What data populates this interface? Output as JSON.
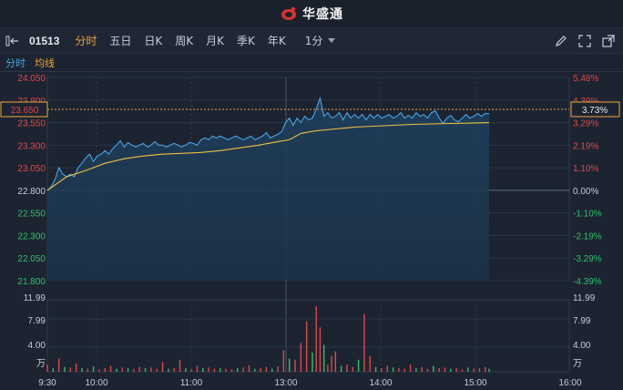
{
  "header": {
    "brand": "华盛通"
  },
  "toolbar": {
    "code": "01513",
    "tabs": [
      "分时",
      "五日",
      "日K",
      "周K",
      "月K",
      "季K",
      "年K"
    ],
    "active_tab": 0,
    "interval": "1分"
  },
  "subtabs": {
    "intraday": "分时",
    "avg": "均线"
  },
  "price_axis": {
    "labels": [
      "24.050",
      "23.800",
      "23.550",
      "23.300",
      "23.050",
      "22.800",
      "22.550",
      "22.300",
      "22.050",
      "21.800"
    ],
    "current": "23.650"
  },
  "pct_axis": {
    "labels": [
      "5.48%",
      "4.39%",
      "3.29%",
      "2.19%",
      "1.10%",
      "0.00%",
      "-1.10%",
      "-2.19%",
      "-3.29%",
      "-4.39%"
    ],
    "current": "3.73%"
  },
  "volume_axis": {
    "left": [
      "11.99",
      "7.99",
      "4.00",
      "万"
    ],
    "right": [
      "11.99",
      "7.99",
      "4.00",
      "万"
    ]
  },
  "time_axis": [
    "9:30",
    "10:00",
    "11:00",
    "13:00",
    "14:00",
    "15:00",
    "16:00"
  ],
  "colors": {
    "price_line": "#4aa3e6",
    "avg_line": "#f0c040",
    "up": "#e04848",
    "down": "#2fc06a",
    "accent": "#f0a33a"
  },
  "chart_data": {
    "type": "line",
    "prev_close": 22.8,
    "ylim": [
      21.8,
      24.05
    ],
    "volume_max": 11.99,
    "price_points": [
      [
        0,
        22.8
      ],
      [
        2,
        22.84
      ],
      [
        4,
        22.92
      ],
      [
        6,
        23.05
      ],
      [
        8,
        22.98
      ],
      [
        10,
        22.95
      ],
      [
        12,
        22.98
      ],
      [
        14,
        22.95
      ],
      [
        16,
        23.05
      ],
      [
        18,
        23.1
      ],
      [
        20,
        23.16
      ],
      [
        22,
        23.2
      ],
      [
        24,
        23.12
      ],
      [
        26,
        23.18
      ],
      [
        28,
        23.2
      ],
      [
        30,
        23.24
      ],
      [
        32,
        23.2
      ],
      [
        34,
        23.26
      ],
      [
        36,
        23.3
      ],
      [
        38,
        23.35
      ],
      [
        40,
        23.28
      ],
      [
        42,
        23.33
      ],
      [
        44,
        23.3
      ],
      [
        46,
        23.28
      ],
      [
        48,
        23.3
      ],
      [
        50,
        23.32
      ],
      [
        52,
        23.28
      ],
      [
        54,
        23.3
      ],
      [
        56,
        23.34
      ],
      [
        58,
        23.3
      ],
      [
        60,
        23.3
      ],
      [
        62,
        23.28
      ],
      [
        64,
        23.3
      ],
      [
        66,
        23.32
      ],
      [
        68,
        23.3
      ],
      [
        70,
        23.28
      ],
      [
        72,
        23.3
      ],
      [
        74,
        23.33
      ],
      [
        76,
        23.32
      ],
      [
        78,
        23.3
      ],
      [
        80,
        23.36
      ],
      [
        82,
        23.38
      ],
      [
        84,
        23.36
      ],
      [
        86,
        23.4
      ],
      [
        88,
        23.38
      ],
      [
        90,
        23.4
      ],
      [
        92,
        23.38
      ],
      [
        94,
        23.36
      ],
      [
        96,
        23.38
      ],
      [
        98,
        23.4
      ],
      [
        100,
        23.38
      ],
      [
        102,
        23.36
      ],
      [
        104,
        23.38
      ],
      [
        106,
        23.4
      ],
      [
        108,
        23.36
      ],
      [
        110,
        23.38
      ],
      [
        112,
        23.4
      ],
      [
        114,
        23.44
      ],
      [
        116,
        23.38
      ],
      [
        118,
        23.4
      ],
      [
        120,
        23.42
      ],
      [
        122,
        23.45
      ],
      [
        124,
        23.55
      ],
      [
        126,
        23.6
      ],
      [
        128,
        23.52
      ],
      [
        130,
        23.6
      ],
      [
        132,
        23.55
      ],
      [
        134,
        23.62
      ],
      [
        136,
        23.58
      ],
      [
        138,
        23.6
      ],
      [
        140,
        23.7
      ],
      [
        142,
        23.82
      ],
      [
        144,
        23.62
      ],
      [
        146,
        23.66
      ],
      [
        148,
        23.6
      ],
      [
        150,
        23.62
      ],
      [
        152,
        23.66
      ],
      [
        154,
        23.58
      ],
      [
        156,
        23.66
      ],
      [
        158,
        23.6
      ],
      [
        160,
        23.64
      ],
      [
        162,
        23.6
      ],
      [
        164,
        23.64
      ],
      [
        166,
        23.58
      ],
      [
        168,
        23.64
      ],
      [
        170,
        23.6
      ],
      [
        172,
        23.64
      ],
      [
        174,
        23.6
      ],
      [
        176,
        23.62
      ],
      [
        178,
        23.64
      ],
      [
        180,
        23.6
      ],
      [
        182,
        23.62
      ],
      [
        184,
        23.66
      ],
      [
        186,
        23.6
      ],
      [
        188,
        23.63
      ],
      [
        190,
        23.6
      ],
      [
        192,
        23.66
      ],
      [
        194,
        23.62
      ],
      [
        196,
        23.64
      ],
      [
        198,
        23.6
      ],
      [
        200,
        23.66
      ],
      [
        202,
        23.68
      ],
      [
        204,
        23.6
      ],
      [
        206,
        23.54
      ],
      [
        208,
        23.6
      ],
      [
        210,
        23.63
      ],
      [
        212,
        23.58
      ],
      [
        214,
        23.56
      ],
      [
        216,
        23.6
      ],
      [
        218,
        23.64
      ],
      [
        220,
        23.6
      ],
      [
        222,
        23.62
      ],
      [
        224,
        23.65
      ],
      [
        226,
        23.62
      ],
      [
        228,
        23.65
      ],
      [
        230,
        23.65
      ]
    ],
    "avg_points": [
      [
        0,
        22.8
      ],
      [
        10,
        22.95
      ],
      [
        20,
        23.02
      ],
      [
        30,
        23.1
      ],
      [
        40,
        23.15
      ],
      [
        50,
        23.18
      ],
      [
        60,
        23.2
      ],
      [
        70,
        23.21
      ],
      [
        80,
        23.22
      ],
      [
        90,
        23.24
      ],
      [
        100,
        23.27
      ],
      [
        110,
        23.3
      ],
      [
        120,
        23.34
      ],
      [
        126,
        23.36
      ],
      [
        132,
        23.43
      ],
      [
        140,
        23.46
      ],
      [
        150,
        23.48
      ],
      [
        160,
        23.5
      ],
      [
        170,
        23.51
      ],
      [
        180,
        23.52
      ],
      [
        190,
        23.53
      ],
      [
        200,
        23.535
      ],
      [
        210,
        23.54
      ],
      [
        220,
        23.545
      ],
      [
        230,
        23.55
      ]
    ],
    "volume": [
      [
        0,
        1.2,
        "u"
      ],
      [
        3,
        0.6,
        "d"
      ],
      [
        6,
        2.2,
        "u"
      ],
      [
        9,
        0.8,
        "d"
      ],
      [
        12,
        0.7,
        "u"
      ],
      [
        15,
        1.4,
        "u"
      ],
      [
        18,
        0.6,
        "d"
      ],
      [
        21,
        0.5,
        "u"
      ],
      [
        24,
        0.9,
        "d"
      ],
      [
        27,
        0.4,
        "u"
      ],
      [
        30,
        0.6,
        "u"
      ],
      [
        33,
        1.0,
        "u"
      ],
      [
        36,
        0.5,
        "d"
      ],
      [
        39,
        0.7,
        "u"
      ],
      [
        42,
        0.6,
        "d"
      ],
      [
        45,
        0.5,
        "u"
      ],
      [
        48,
        0.8,
        "u"
      ],
      [
        51,
        0.6,
        "d"
      ],
      [
        54,
        0.7,
        "u"
      ],
      [
        57,
        0.5,
        "u"
      ],
      [
        60,
        1.6,
        "u"
      ],
      [
        63,
        0.5,
        "d"
      ],
      [
        66,
        0.6,
        "u"
      ],
      [
        69,
        2.0,
        "u"
      ],
      [
        72,
        0.6,
        "d"
      ],
      [
        75,
        0.4,
        "u"
      ],
      [
        78,
        1.0,
        "u"
      ],
      [
        81,
        0.6,
        "d"
      ],
      [
        84,
        0.7,
        "u"
      ],
      [
        87,
        0.5,
        "u"
      ],
      [
        90,
        0.6,
        "d"
      ],
      [
        93,
        0.5,
        "u"
      ],
      [
        96,
        0.4,
        "u"
      ],
      [
        99,
        0.6,
        "d"
      ],
      [
        102,
        0.7,
        "u"
      ],
      [
        105,
        1.1,
        "u"
      ],
      [
        108,
        0.5,
        "d"
      ],
      [
        111,
        0.6,
        "u"
      ],
      [
        114,
        0.8,
        "u"
      ],
      [
        117,
        0.5,
        "d"
      ],
      [
        120,
        0.9,
        "u"
      ],
      [
        123,
        3.6,
        "u"
      ],
      [
        126,
        2.2,
        "d"
      ],
      [
        129,
        2.0,
        "u"
      ],
      [
        132,
        4.8,
        "u"
      ],
      [
        135,
        8.4,
        "u"
      ],
      [
        138,
        3.2,
        "d"
      ],
      [
        140,
        10.9,
        "u"
      ],
      [
        142,
        7.4,
        "u"
      ],
      [
        144,
        4.5,
        "d"
      ],
      [
        146,
        1.2,
        "u"
      ],
      [
        148,
        2.6,
        "u"
      ],
      [
        150,
        3.4,
        "u"
      ],
      [
        153,
        1.0,
        "d"
      ],
      [
        156,
        1.2,
        "u"
      ],
      [
        159,
        0.8,
        "u"
      ],
      [
        162,
        2.0,
        "d"
      ],
      [
        165,
        9.6,
        "u"
      ],
      [
        168,
        2.6,
        "u"
      ],
      [
        171,
        0.8,
        "d"
      ],
      [
        174,
        0.6,
        "u"
      ],
      [
        177,
        1.0,
        "u"
      ],
      [
        180,
        0.7,
        "d"
      ],
      [
        183,
        0.6,
        "u"
      ],
      [
        186,
        0.5,
        "u"
      ],
      [
        189,
        1.2,
        "u"
      ],
      [
        192,
        0.6,
        "d"
      ],
      [
        195,
        0.8,
        "u"
      ],
      [
        198,
        0.5,
        "u"
      ],
      [
        201,
        1.0,
        "d"
      ],
      [
        204,
        0.6,
        "u"
      ],
      [
        207,
        0.7,
        "u"
      ],
      [
        210,
        0.5,
        "d"
      ],
      [
        213,
        0.6,
        "u"
      ],
      [
        216,
        0.4,
        "u"
      ],
      [
        219,
        0.7,
        "d"
      ],
      [
        222,
        0.5,
        "u"
      ],
      [
        225,
        0.6,
        "u"
      ],
      [
        228,
        0.8,
        "u"
      ],
      [
        230,
        0.5,
        "d"
      ]
    ]
  }
}
